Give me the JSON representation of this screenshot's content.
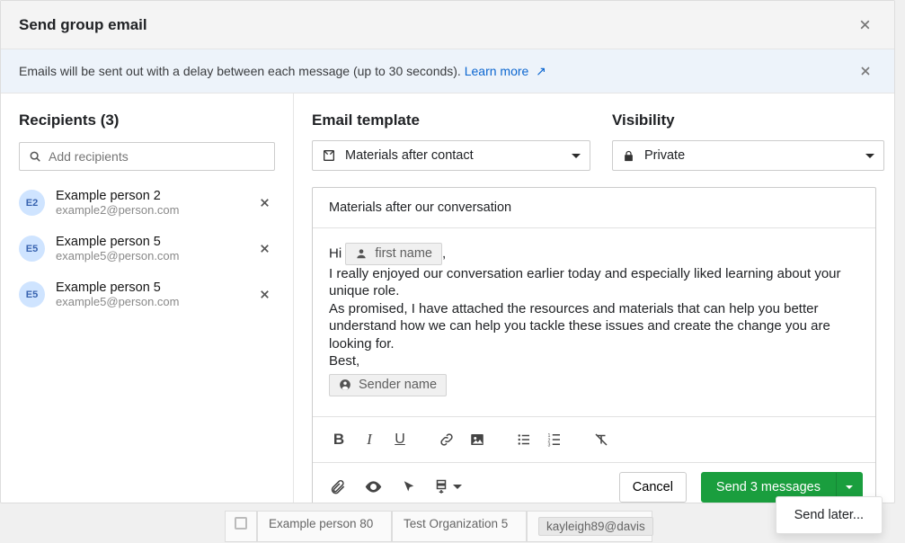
{
  "header": {
    "title": "Send group email"
  },
  "banner": {
    "text": "Emails will be sent out with a delay between each message (up to 30 seconds). ",
    "link_label": "Learn more"
  },
  "recipients": {
    "title": "Recipients (3)",
    "placeholder": "Add recipients",
    "items": [
      {
        "initials": "E2",
        "name": "Example person 2",
        "email": "example2@person.com"
      },
      {
        "initials": "E5",
        "name": "Example person 5",
        "email": "example5@person.com"
      },
      {
        "initials": "E5",
        "name": "Example person 5",
        "email": "example5@person.com"
      }
    ]
  },
  "template": {
    "label": "Email template",
    "value": "Materials after contact"
  },
  "visibility": {
    "label": "Visibility",
    "value": "Private"
  },
  "email": {
    "subject": "Materials after our conversation",
    "greeting_prefix": "Hi ",
    "merge_first_name": "first name",
    "comma": ",",
    "body_para1": "I really enjoyed our conversation earlier today and especially liked learning about your unique role.",
    "body_para2": "As promised, I have attached the resources and materials that can help you better understand how we can help you tackle these issues and create the change you are looking for.",
    "body_sign": "Best,",
    "merge_sender": "Sender name"
  },
  "actions": {
    "cancel": "Cancel",
    "send": "Send 3 messages",
    "send_later": "Send later..."
  },
  "bg_table": {
    "name": "Example person 80",
    "org": "Test Organization 5",
    "email": "kayleigh89@davis"
  }
}
